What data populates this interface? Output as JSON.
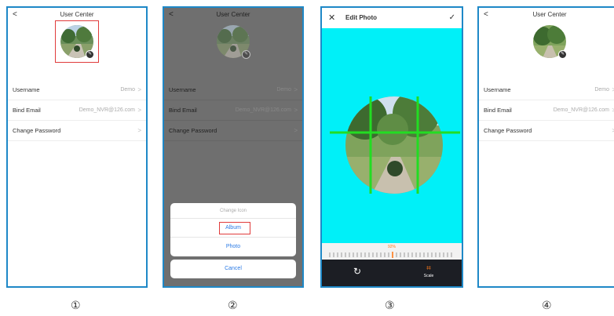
{
  "user_center": {
    "title": "User Center",
    "back": "<",
    "rows": [
      {
        "label": "Username",
        "value": "Demo",
        "arrow": ">"
      },
      {
        "label": "Bind Email",
        "value": "Demo_NVR@126.com",
        "arrow": ">"
      },
      {
        "label": "Change Password",
        "value": "",
        "arrow": ">"
      }
    ],
    "edit_badge": "✎"
  },
  "action_sheet": {
    "title": "Change Icon",
    "options": [
      "Album",
      "Photo"
    ],
    "cancel": "Cancel"
  },
  "edit_photo": {
    "close": "✕",
    "title": "Edit Photo",
    "confirm": "✓",
    "zoom_percent": "92%",
    "rotate_icon": "↻",
    "scale_icon": "⌗",
    "scale_label": "Scale"
  },
  "captions": [
    "①",
    "②",
    "③",
    "④"
  ],
  "colors": {
    "panel_border": "#1e88c7",
    "highlight": "#e03b3b",
    "crop_background": "#00f0f8",
    "accent_orange": "#ff7a1a",
    "link_blue": "#2c7be5"
  }
}
